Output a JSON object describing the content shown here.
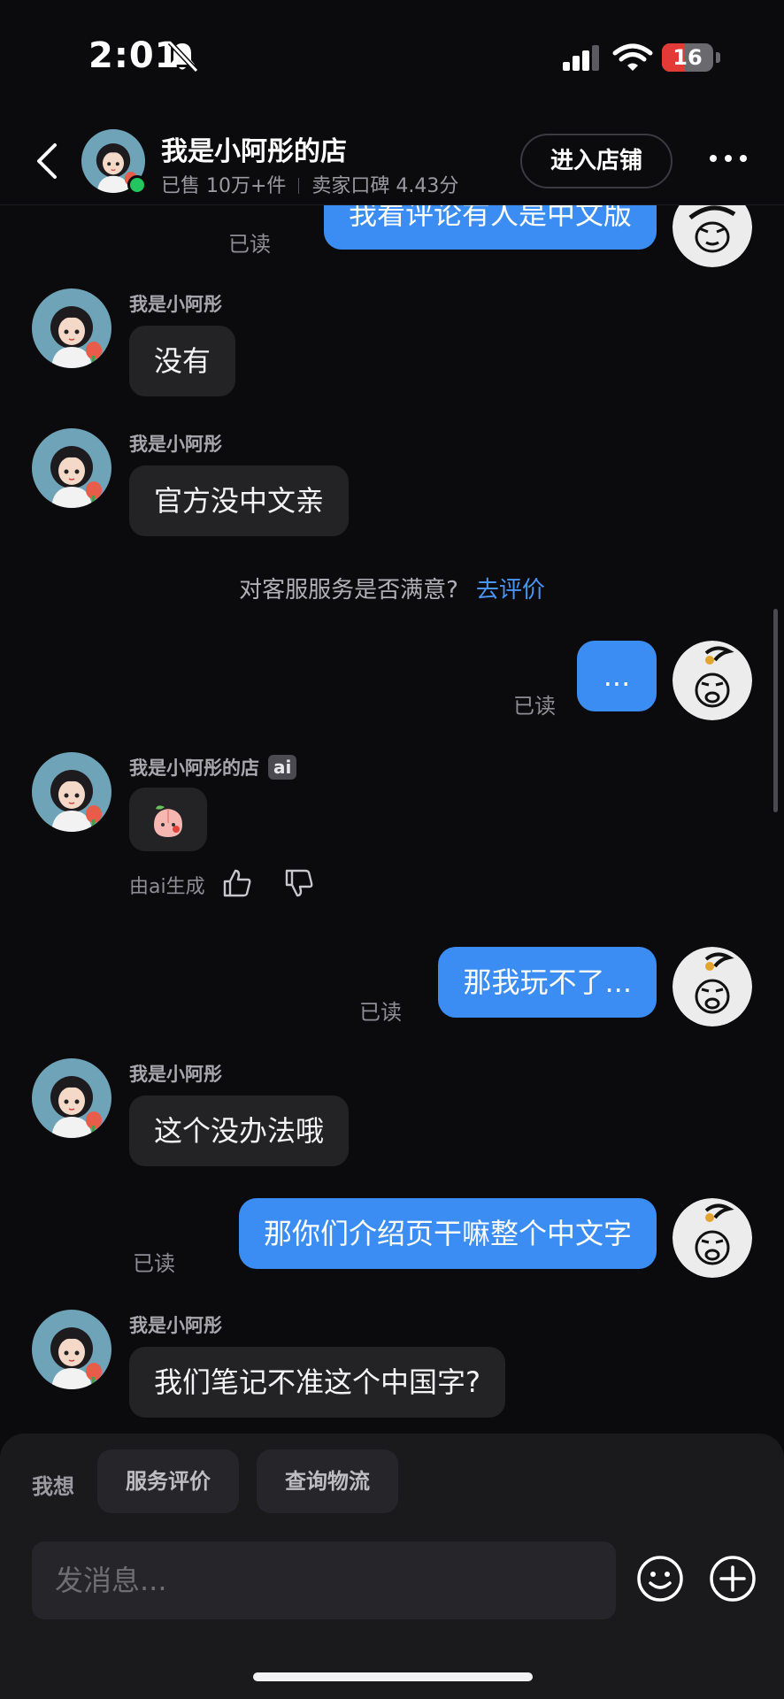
{
  "status_bar": {
    "time": "2:01",
    "battery": "16",
    "battery_level": 0.16
  },
  "header": {
    "shop_name": "我是小阿彤的店",
    "sold": "已售 10万+件",
    "rating": "卖家口碑 4.43分",
    "enter_shop": "进入店铺"
  },
  "chat": {
    "messages": [
      {
        "side": "out",
        "text": "我看评论有人是中文版",
        "read": "已读"
      },
      {
        "side": "in",
        "sender": "我是小阿彤",
        "text": "没有"
      },
      {
        "side": "in",
        "sender": "我是小阿彤",
        "text": "官方没中文亲"
      },
      {
        "side": "out",
        "text": "...",
        "read": "已读"
      },
      {
        "side": "in",
        "sender": "我是小阿彤的店",
        "tag": "ai",
        "text": "🍑"
      },
      {
        "side": "out",
        "text": "那我玩不了...",
        "read": "已读"
      },
      {
        "side": "in",
        "sender": "我是小阿彤",
        "text": "这个没办法哦"
      },
      {
        "side": "out",
        "text": "那你们介绍页干嘛整个中文字",
        "read": "已读"
      },
      {
        "side": "in",
        "sender": "我是小阿彤",
        "text": "我们笔记不准这个中国字?"
      }
    ],
    "satisfaction": {
      "question": "对客服服务是否满意?",
      "link": "去评价"
    },
    "ai_generated": "由ai生成"
  },
  "bottom": {
    "want_label": "我想",
    "chips": [
      "服务评价",
      "查询物流"
    ],
    "input_placeholder": "发消息..."
  },
  "colors": {
    "accent": "#3b8cf3",
    "bubble_in": "#232326",
    "background": "#0b0b0d"
  }
}
